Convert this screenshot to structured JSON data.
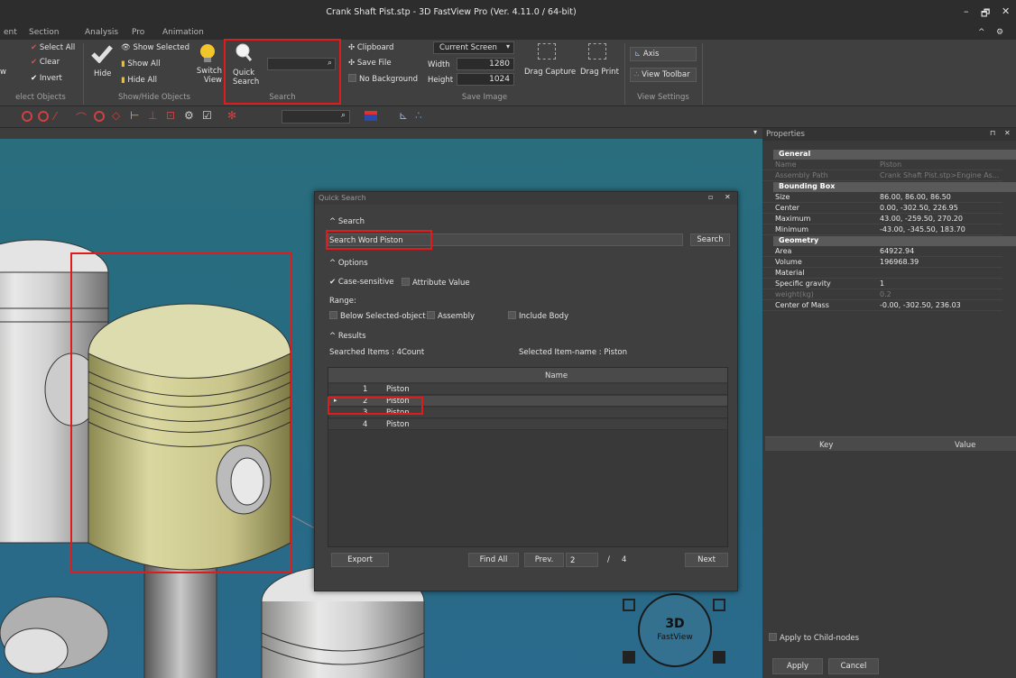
{
  "window": {
    "title": "Crank Shaft Pist.stp - 3D FastView Pro (Ver. 4.11.0 / 64-bit)",
    "minimize": "–",
    "restore": "🗗",
    "close": "✕",
    "help": "^",
    "options": "⚙"
  },
  "menu": [
    "ent",
    "Section",
    "Analysis",
    "Pro",
    "Animation"
  ],
  "ribbon": {
    "select": {
      "view": "w",
      "select_all": "Select All",
      "clear": "Clear",
      "invert": "Invert",
      "group": "elect Objects"
    },
    "show_hide": {
      "hide": "Hide",
      "show_selected": "Show Selected",
      "show_all": "Show All",
      "hide_all": "Hide All",
      "switch_view": "Switch View",
      "group": "Show/Hide Objects"
    },
    "search": {
      "quick_search": "Quick Search",
      "value": "",
      "group": "Search"
    },
    "save_image": {
      "clipboard": "Clipboard",
      "save_file": "Save File",
      "no_background": "No Background",
      "screen_option": "Current Screen",
      "width_label": "Width",
      "width": "1280",
      "height_label": "Height",
      "height": "1024",
      "drag_capture": "Drag Capture",
      "drag_print": "Drag Print",
      "group": "Save Image"
    },
    "view_settings": {
      "axis": "Axis",
      "view_toolbar": "View Toolbar",
      "group": "View Settings"
    }
  },
  "properties": {
    "title": "Properties",
    "pin": "⊓",
    "close": "✕",
    "general": "General",
    "name_label": "Name",
    "name_value": "Piston",
    "assembly_label": "Assembly Path",
    "assembly_value": "Crank Shaft Pist.stp>Engine As...",
    "bounding_box": "Bounding Box",
    "size_label": "Size",
    "size_value": "86.00, 86.00, 86.50",
    "center_label": "Center",
    "center_value": "0.00, -302.50, 226.95",
    "max_label": "Maximum",
    "max_value": "43.00, -259.50, 270.20",
    "min_label": "Minimum",
    "min_value": "-43.00, -345.50, 183.70",
    "geometry": "Geometry",
    "area_label": "Area",
    "area_value": "64922.94",
    "volume_label": "Volume",
    "volume_value": "196968.39",
    "material_label": "Material",
    "material_value": "",
    "gravity_label": "Specific gravity",
    "gravity_value": "1",
    "weight_label": "weight(kg)",
    "weight_value": "0.2",
    "com_label": "Center of Mass",
    "com_value": "-0.00, -302.50, 236.03",
    "key_header": "Key",
    "value_header": "Value",
    "apply_child": "Apply to Child-nodes",
    "apply": "Apply",
    "cancel": "Cancel"
  },
  "dialog": {
    "title": "Quick Search",
    "search_section": "Search",
    "search_word_label": "Search Word",
    "search_word_value": "Piston",
    "search_button": "Search",
    "options_section": "Options",
    "case_sensitive": "Case-sensitive",
    "attribute_value": "Attribute Value",
    "range_label": "Range:",
    "below_selected": "Below Selected-object",
    "assembly": "Assembly",
    "include_body": "Include Body",
    "results_section": "Results",
    "searched_items": "Searched Items : 4Count",
    "selected_item": "Selected Item-name : Piston",
    "name_header": "Name",
    "rows": [
      {
        "num": "1",
        "name": "Piston"
      },
      {
        "num": "2",
        "name": "Piston"
      },
      {
        "num": "3",
        "name": "Piston"
      },
      {
        "num": "4",
        "name": "Piston"
      }
    ],
    "export": "Export",
    "find_all": "Find All",
    "prev": "Prev.",
    "page": "2",
    "slash": "/",
    "total": "4",
    "next": "Next"
  },
  "logo": {
    "line1": "3D",
    "line2": "FastView"
  }
}
